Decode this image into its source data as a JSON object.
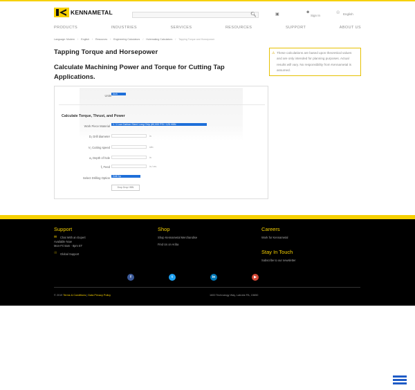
{
  "header": {
    "brand": "KENNAMETAL",
    "search_placeholder": "",
    "sign_in": "Sign In",
    "language": "English"
  },
  "nav": [
    "PRODUCTS",
    "INDUSTRIES",
    "SERVICES",
    "RESOURCES",
    "SUPPORT",
    "ABOUT US"
  ],
  "breadcrumb": [
    "Language: Modern",
    "English",
    "Resources",
    "Engineering Calculators",
    "Holemaking Calculators",
    "Tapping Torque and Horsepower"
  ],
  "page": {
    "title": "Tapping Torque and Horsepower",
    "subtitle": "Calculate Machining Power and Torque for Cutting Tap Applications.",
    "notice": "These calculations are based upon theoretical values and are only intended for planning purposes. Actual results will vary. No responsibility from Kennametal is assumed."
  },
  "form": {
    "units_label": "Units",
    "units_value": "Inch",
    "section_title": "Calculate Torque, Thrust, and Power",
    "material_label": "Work Piece Material",
    "material_value": "1. 1 Low Carbon Steel: Long Chip (80,000 PSI / 125 HBN",
    "drill_diameter_label": "D₁ Drill diameter",
    "drill_diameter_unit": "in",
    "cutting_speed_label": "V₁ Cutting speed",
    "cutting_speed_unit": "sfm",
    "depth_label": "a₁ Depth of hole",
    "depth_unit": "in",
    "feed_label": "f₁ Feed",
    "feed_unit": "in / rev",
    "drilling_option_label": "Select Drilling Option",
    "drilling_option_value": "Drill Dp",
    "calc_button": "Drop Drop HBN"
  },
  "footer": {
    "support_title": "Support",
    "chat": "Chat With an Expert",
    "available": "Available Now",
    "hours": "Mon-Fri 8am - 8pm ET",
    "global_support": "Global Support",
    "shop_title": "Shop",
    "shop_merch": "Shop Kennametal Merchandise",
    "find_ariba": "Find Us on Ariba",
    "careers_title": "Careers",
    "work_for": "Work for Kennametal",
    "stay_title": "Stay In Touch",
    "subscribe": "Subscribe to our newsletter",
    "copyright": "© 2019",
    "terms": "Terms & Conditions",
    "privacy": "Data Privacy Policy",
    "address": "1600 Technology Way, Latrobe PA, 15650"
  },
  "colors": {
    "brand_yellow": "#f6d000",
    "select_blue": "#1e6fd9"
  }
}
